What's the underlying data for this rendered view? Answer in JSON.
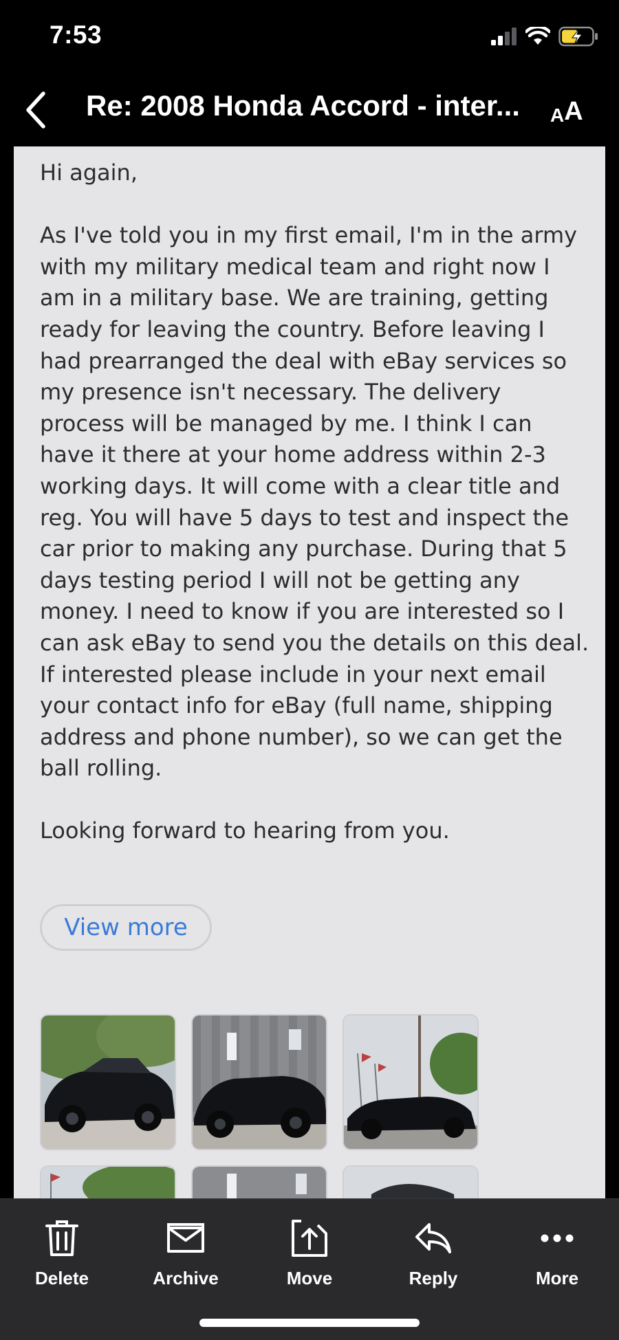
{
  "status": {
    "time": "7:53",
    "icons": [
      "cellular-signal-icon",
      "wifi-icon",
      "battery-charging-icon"
    ]
  },
  "nav": {
    "back_icon": "chevron-left-icon",
    "title": "Re: 2008 Honda Accord - inter...",
    "font_size_label_large": "A",
    "font_size_label_small": "A"
  },
  "email": {
    "paragraphs": [
      "Hi again,",
      "As I've told you in my first email, I'm in the army with my military medical team and right now I am in a military base. We are training, getting ready for leaving the country. Before leaving I had prearranged the deal with eBay services so my presence isn't necessary. The delivery process will be managed by me. I think I can have it there at your home address within 2-3 working days. It will come with a clear title and reg. You will have 5 days to test and inspect the  car  prior to making any purchase. During that 5 days testing period I will not be getting any money. I need to know if you are interested so I can ask eBay to send you the details on this deal. If interested please include in your next email your contact info for eBay (full name, shipping address and phone number), so we can get the ball rolling.",
      "Looking forward to hearing from you."
    ],
    "view_more_label": "View more",
    "attachments": [
      "car-photo-1",
      "car-photo-2",
      "car-photo-3",
      "car-photo-4",
      "car-photo-5",
      "car-photo-6"
    ]
  },
  "toolbar": {
    "items": [
      {
        "label": "Delete",
        "icon": "trash-icon"
      },
      {
        "label": "Archive",
        "icon": "archive-icon"
      },
      {
        "label": "Move",
        "icon": "move-icon"
      },
      {
        "label": "Reply",
        "icon": "reply-icon"
      },
      {
        "label": "More",
        "icon": "more-dots-icon"
      }
    ]
  },
  "colors": {
    "background": "#000000",
    "email_card": "#e5e5e7",
    "link": "#3a7ad8",
    "toolbar": "#2a2a2c",
    "battery_charging": "#f6d43b"
  }
}
